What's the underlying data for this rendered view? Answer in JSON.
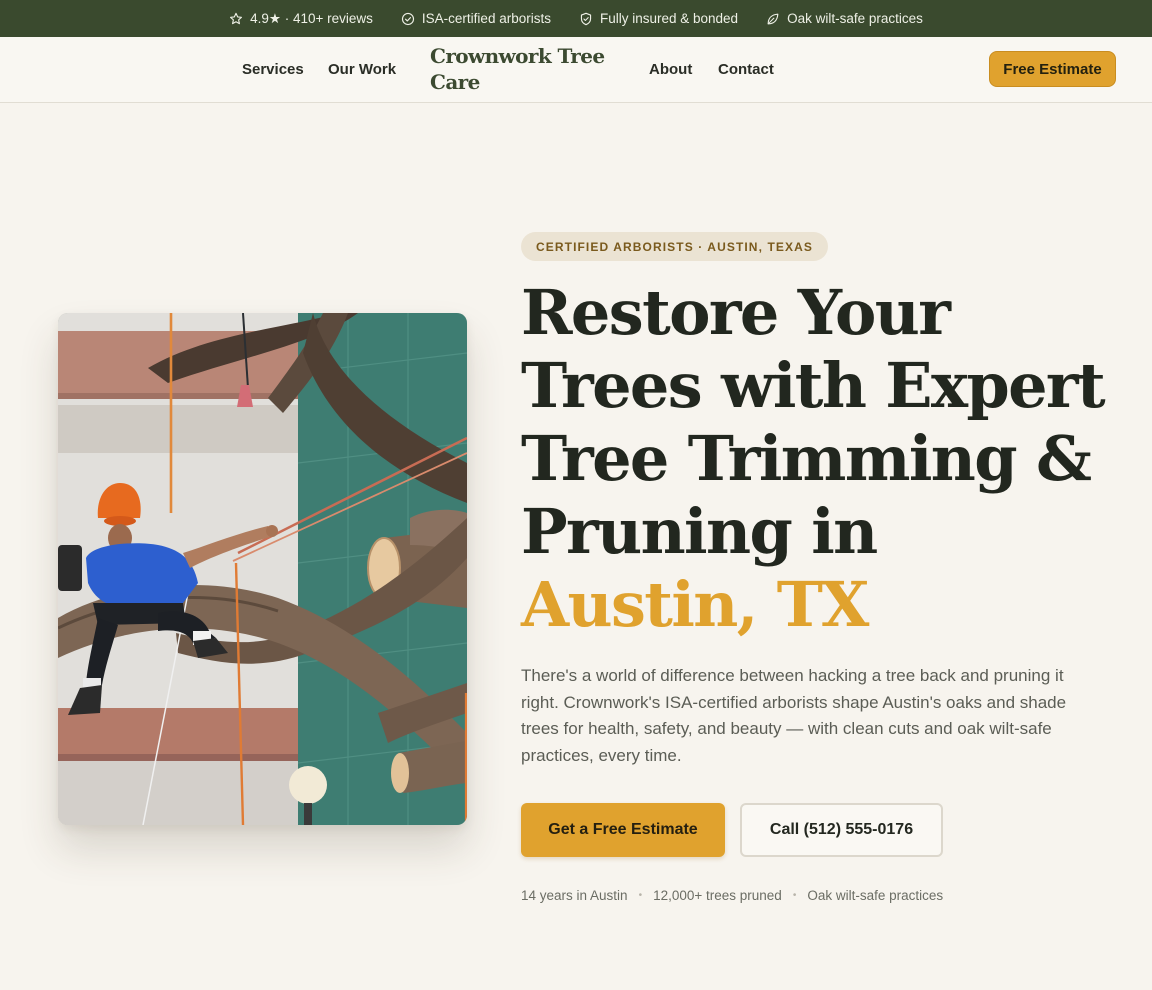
{
  "topbar": {
    "items": [
      {
        "icon": "star-icon",
        "label": "4.9★ · 410+ reviews"
      },
      {
        "icon": "check-circle-icon",
        "label": "ISA-certified arborists"
      },
      {
        "icon": "shield-icon",
        "label": "Fully insured & bonded"
      },
      {
        "icon": "leaf-icon",
        "label": "Oak wilt-safe practices"
      }
    ]
  },
  "header": {
    "nav_left": [
      "Services",
      "Our Work"
    ],
    "brand": "Crownwork Tree Care",
    "nav_right": [
      "About",
      "Contact"
    ],
    "cta_label": "Free Estimate"
  },
  "hero": {
    "eyebrow": "CERTIFIED ARBORISTS · AUSTIN, TEXAS",
    "headline": "Restore Your Trees with Expert Tree Trimming & Pruning in",
    "headline_accent": "Austin, TX",
    "lead": "There's a world of difference between hacking a tree back and pruning it right. Crownwork's ISA-certified arborists shape Austin's oaks and shade trees for health, safety, and beauty — with clean cuts and oak wilt-safe practices, every time.",
    "primary_cta": "Get a Free Estimate",
    "secondary_cta": "Call (512) 555-0176",
    "stats": [
      "14 years in Austin",
      "12,000+ trees pruned",
      "Oak wilt-safe practices"
    ]
  },
  "colors": {
    "topbar_bg": "#3a4a2e",
    "accent": "#e0a22e",
    "page_bg": "#f7f4ee",
    "brand_text": "#3c4a31"
  }
}
